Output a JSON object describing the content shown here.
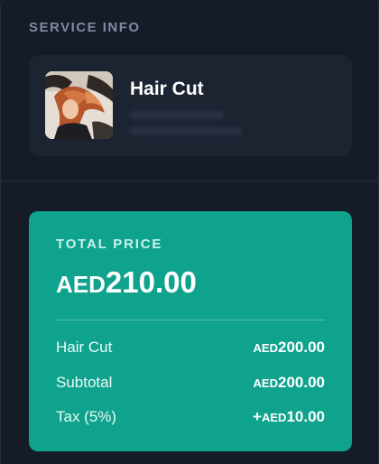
{
  "service_info": {
    "heading": "SERVICE INFO",
    "service": {
      "name": "Hair Cut",
      "image_icon": "hair-salon-photo"
    }
  },
  "total_price": {
    "label": "TOTAL PRICE",
    "currency": "AED",
    "amount": "210.00",
    "rows": [
      {
        "label": "Hair Cut",
        "prefix": "",
        "currency": "AED",
        "amount": "200.00"
      },
      {
        "label": "Subtotal",
        "prefix": "",
        "currency": "AED",
        "amount": "200.00"
      },
      {
        "label": "Tax (5%)",
        "prefix": "+",
        "currency": "AED",
        "amount": "10.00"
      }
    ]
  },
  "colors": {
    "background": "#151b27",
    "card": "#1c2331",
    "accent": "#0fa38e"
  }
}
